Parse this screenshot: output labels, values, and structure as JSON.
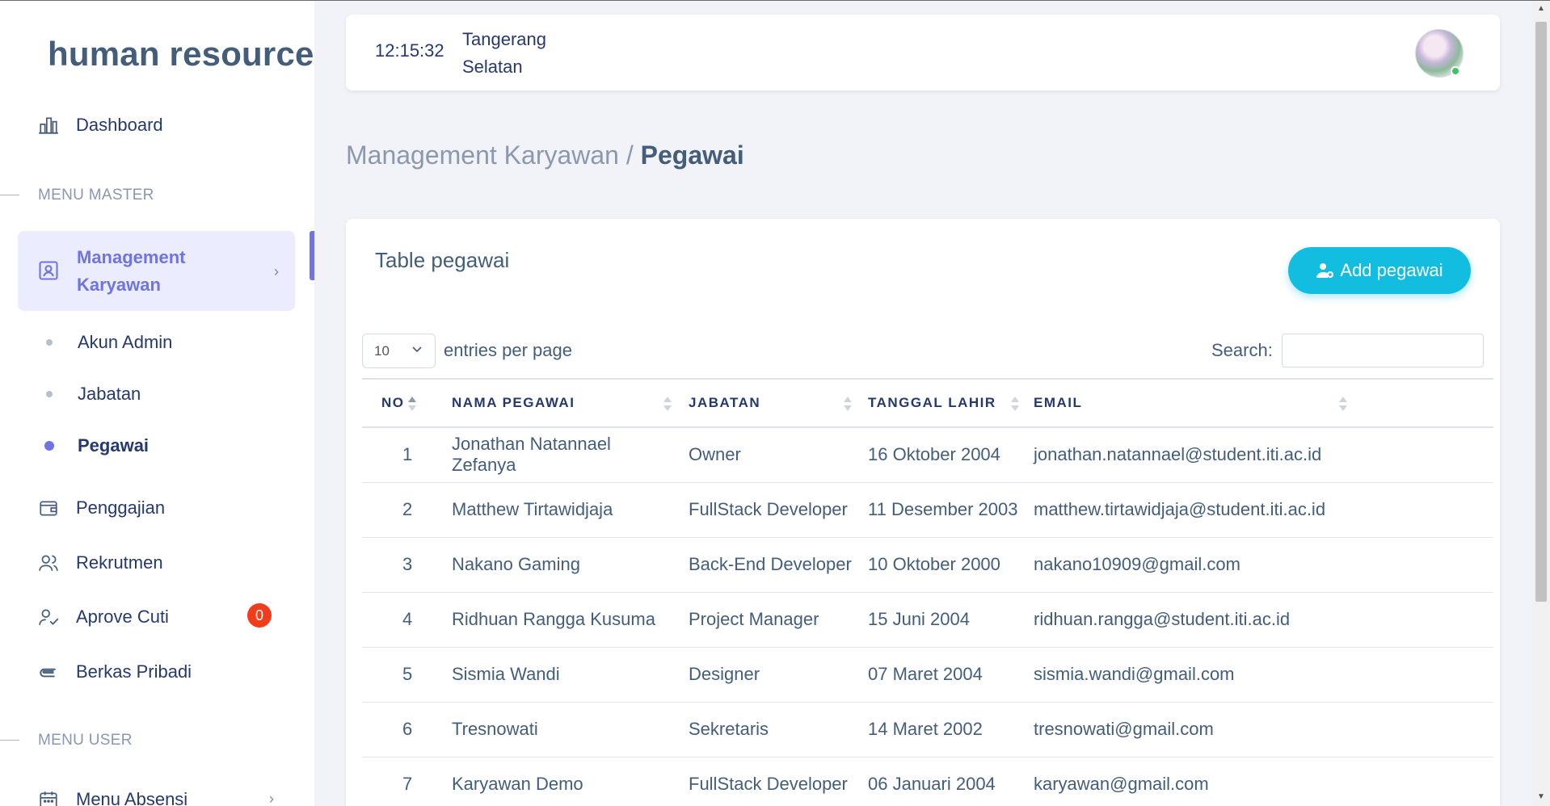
{
  "sidebar": {
    "brand": "human resource",
    "dashboard_label": "Dashboard",
    "menu_master_title": "MENU MASTER",
    "management_label": "Management Karyawan",
    "sub_items": [
      "Akun Admin",
      "Jabatan",
      "Pegawai"
    ],
    "penggajian_label": "Penggajian",
    "rekrutmen_label": "Rekrutmen",
    "aprove_cuti_label": "Aprove Cuti",
    "aprove_cuti_badge": "0",
    "berkas_label": "Berkas Pribadi",
    "menu_user_title": "MENU USER",
    "menu_absensi_label": "Menu Absensi"
  },
  "header": {
    "clock": "12:15:32",
    "location": "Tangerang Selatan"
  },
  "breadcrumb": {
    "parent": "Management Karyawan",
    "separator": " / ",
    "current": "Pegawai"
  },
  "card": {
    "title": "Table pegawai",
    "add_button": "Add pegawai",
    "entries_value": "10",
    "entries_label": "entries per page",
    "search_label": "Search:",
    "search_value": ""
  },
  "table": {
    "columns": [
      "NO",
      "NAMA PEGAWAI",
      "JABATAN",
      "TANGGAL LAHIR",
      "EMAIL"
    ],
    "rows": [
      [
        "1",
        "Jonathan Natannael Zefanya",
        "Owner",
        "16 Oktober 2004",
        "jonathan.natannael@student.iti.ac.id"
      ],
      [
        "2",
        "Matthew Tirtawidjaja",
        "FullStack Developer",
        "11 Desember 2003",
        "matthew.tirtawidjaja@student.iti.ac.id"
      ],
      [
        "3",
        "Nakano Gaming",
        "Back-End Developer",
        "10 Oktober 2000",
        "nakano10909@gmail.com"
      ],
      [
        "4",
        "Ridhuan Rangga Kusuma",
        "Project Manager",
        "15 Juni 2004",
        "ridhuan.rangga@student.iti.ac.id"
      ],
      [
        "5",
        "Sismia Wandi",
        "Designer",
        "07 Maret 2004",
        "sismia.wandi@gmail.com"
      ],
      [
        "6",
        "Tresnowati",
        "Sekretaris",
        "14 Maret 2002",
        "tresnowati@gmail.com"
      ],
      [
        "7",
        "Karyawan Demo",
        "FullStack Developer",
        "06 Januari 2004",
        "karyawan@gmail.com"
      ]
    ]
  },
  "colors": {
    "accent": "#6f74e2",
    "button": "#13bde0",
    "badge": "#f03d1c",
    "online": "#3dc46b"
  }
}
